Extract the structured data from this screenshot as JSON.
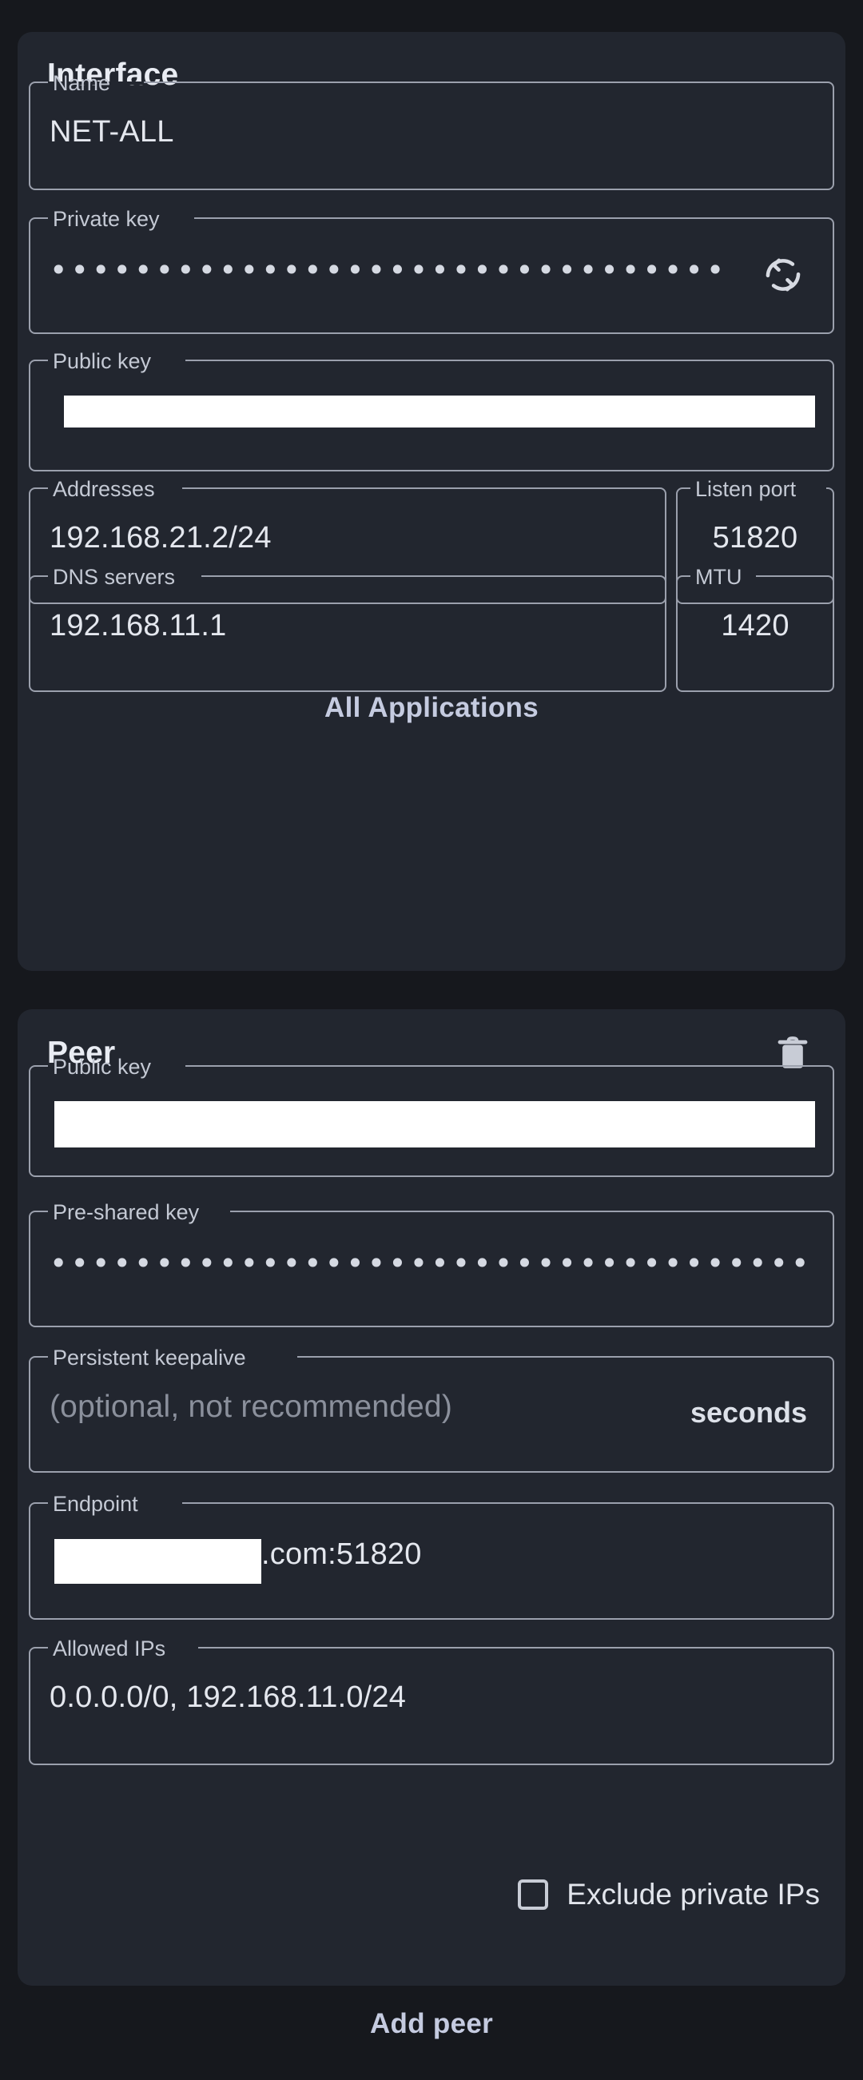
{
  "app": {
    "theme": {
      "page_bg": "#16181d",
      "card_bg": "#22262f",
      "outline": "#9ba0ad",
      "text": "#e4e7ee",
      "muted_text": "#8b909c",
      "accent_text": "#c5cbe0",
      "redaction": "#ffffff"
    }
  },
  "interface": {
    "title": "Interface",
    "fields": {
      "name": {
        "label": "Name",
        "value": "NET-ALL"
      },
      "private_key": {
        "label": "Private key",
        "value": "••••••••••••••••••••••••••••••••••••••••••••",
        "masked": true
      },
      "public_key": {
        "label": "Public key",
        "value": "",
        "redacted": true
      },
      "addresses": {
        "label": "Addresses",
        "value": "192.168.21.2/24"
      },
      "listen_port": {
        "label": "Listen port",
        "value": "51820"
      },
      "dns_servers": {
        "label": "DNS servers",
        "value": "192.168.11.1"
      },
      "mtu": {
        "label": "MTU",
        "value": "1420"
      }
    },
    "generate_key_icon": "sync-refresh-icon",
    "applications_button": "All Applications"
  },
  "peer": {
    "title": "Peer",
    "delete_icon": "trash-icon",
    "fields": {
      "public_key": {
        "label": "Public key",
        "value": "",
        "redacted": true
      },
      "pre_shared_key": {
        "label": "Pre-shared key",
        "value": "•••••••••••••••••••••••••••••••••••••••••••",
        "masked": true
      },
      "persistent_keepalive": {
        "label": "Persistent keepalive",
        "value": "",
        "placeholder": "(optional, not recommended)",
        "suffix": "seconds"
      },
      "endpoint": {
        "label": "Endpoint",
        "value": ".com:51820",
        "redacted_prefix": true
      },
      "allowed_ips": {
        "label": "Allowed IPs",
        "value": "0.0.0.0/0, 192.168.11.0/24"
      }
    },
    "exclude_private_ips": {
      "label": "Exclude private IPs",
      "checked": false
    }
  },
  "footer": {
    "add_peer_button": "Add peer"
  }
}
